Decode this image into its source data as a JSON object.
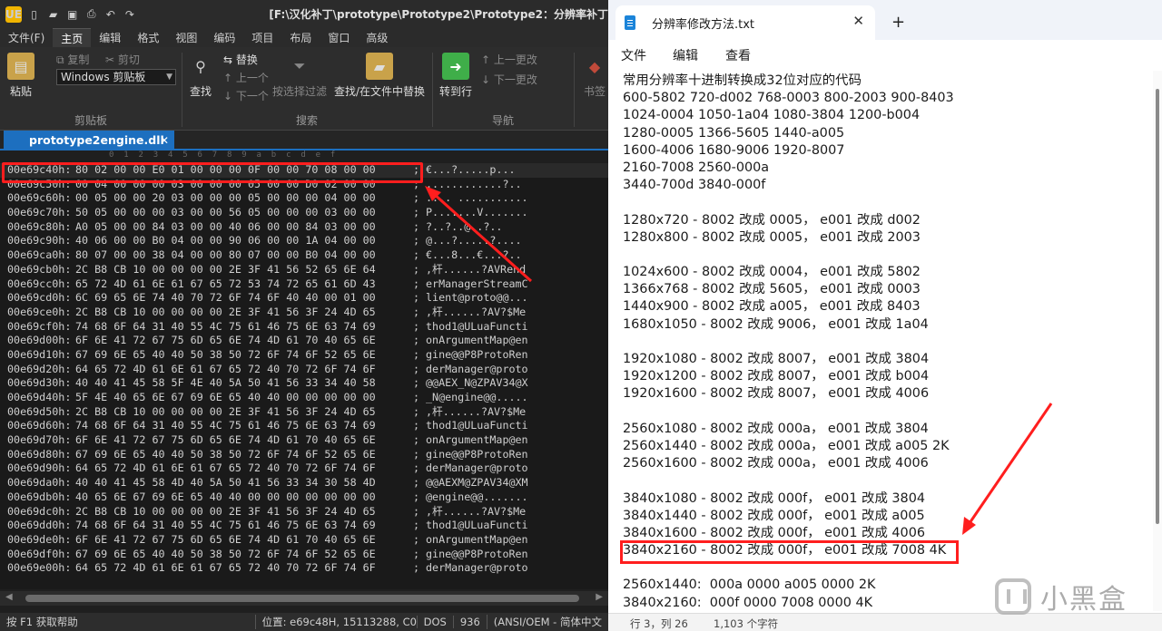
{
  "editor": {
    "logo": "UE",
    "title": "[F:\\汉化补丁\\prototype\\Prototype2\\Prototype2：分辨率补丁",
    "menu": [
      "文件(F)",
      "主页",
      "编辑",
      "格式",
      "视图",
      "编码",
      "项目",
      "布局",
      "窗口",
      "高级"
    ],
    "active_menu": "主页",
    "ribbon": {
      "paste": "粘贴",
      "copy": "复制",
      "cut": "剪切",
      "clipboard_select": "Windows 剪贴板",
      "clipboard_group": "剪贴板",
      "find": "查找",
      "replace": "替换",
      "prev": "上一个",
      "next": "下一个",
      "filter": "按选择过滤",
      "find_in_files": "查找/在文件中替换",
      "search_group": "搜索",
      "goto": "转到行",
      "prev_change": "上一更改",
      "next_change": "下一更改",
      "nav_group": "导航",
      "bookmark": "书签"
    },
    "file_tab": "prototype2engine.dll",
    "ruler": "0  1  2  3  4  5  6  7  8  9  a  b  c  d  e  f",
    "rows": [
      {
        "addr": "00e69c40h:",
        "hex": "80 02 00 00 E0 01 00 00 00 0F 00 00 70 08 00 00",
        "ascii": "€...?.....p..."
      },
      {
        "addr": "00e69c50h:",
        "hex": "00 04 00 00 00 03 00 00 00 05 00 00 D0 02 00 00",
        "ascii": "............?.."
      },
      {
        "addr": "00e69c60h:",
        "hex": "00 05 00 00 20 03 00 00 00 05 00 00 00 04 00 00",
        "ascii": ".... ..........."
      },
      {
        "addr": "00e69c70h:",
        "hex": "50 05 00 00 00 03 00 00 56 05 00 00 00 03 00 00",
        "ascii": "P.......V......."
      },
      {
        "addr": "00e69c80h:",
        "hex": "A0 05 00 00 84 03 00 00 40 06 00 00 84 03 00 00",
        "ascii": "?..?..@..?.."
      },
      {
        "addr": "00e69c90h:",
        "hex": "40 06 00 00 B0 04 00 00 90 06 00 00 1A 04 00 00",
        "ascii": "@...?.....?...."
      },
      {
        "addr": "00e69ca0h:",
        "hex": "80 07 00 00 38 04 00 00 80 07 00 00 B0 04 00 00",
        "ascii": "€...8...€...?.."
      },
      {
        "addr": "00e69cb0h:",
        "hex": "2C B8 CB 10 00 00 00 00 2E 3F 41 56 52 65 6E 64",
        "ascii": ",杆......?AVRend"
      },
      {
        "addr": "00e69cc0h:",
        "hex": "65 72 4D 61 6E 61 67 65 72 53 74 72 65 61 6D 43",
        "ascii": "erManagerStreamC"
      },
      {
        "addr": "00e69cd0h:",
        "hex": "6C 69 65 6E 74 40 70 72 6F 74 6F 40 40 00 01 00",
        "ascii": "lient@proto@@..."
      },
      {
        "addr": "00e69ce0h:",
        "hex": "2C B8 CB 10 00 00 00 00 2E 3F 41 56 3F 24 4D 65",
        "ascii": ",杆......?AV?$Me"
      },
      {
        "addr": "00e69cf0h:",
        "hex": "74 68 6F 64 31 40 55 4C 75 61 46 75 6E 63 74 69",
        "ascii": "thod1@ULuaFuncti"
      },
      {
        "addr": "00e69d00h:",
        "hex": "6F 6E 41 72 67 75 6D 65 6E 74 4D 61 70 40 65 6E",
        "ascii": "onArgumentMap@en"
      },
      {
        "addr": "00e69d10h:",
        "hex": "67 69 6E 65 40 40 50 38 50 72 6F 74 6F 52 65 6E",
        "ascii": "gine@@P8ProtoRen"
      },
      {
        "addr": "00e69d20h:",
        "hex": "64 65 72 4D 61 6E 61 67 65 72 40 70 72 6F 74 6F",
        "ascii": "derManager@proto"
      },
      {
        "addr": "00e69d30h:",
        "hex": "40 40 41 45 58 5F 4E 40 5A 50 41 56 33 34 40 58",
        "ascii": "@@AEX_N@ZPAV34@X"
      },
      {
        "addr": "00e69d40h:",
        "hex": "5F 4E 40 65 6E 67 69 6E 65 40 40 00 00 00 00 00",
        "ascii": "_N@engine@@....."
      },
      {
        "addr": "00e69d50h:",
        "hex": "2C B8 CB 10 00 00 00 00 2E 3F 41 56 3F 24 4D 65",
        "ascii": ",杆......?AV?$Me"
      },
      {
        "addr": "00e69d60h:",
        "hex": "74 68 6F 64 31 40 55 4C 75 61 46 75 6E 63 74 69",
        "ascii": "thod1@ULuaFuncti"
      },
      {
        "addr": "00e69d70h:",
        "hex": "6F 6E 41 72 67 75 6D 65 6E 74 4D 61 70 40 65 6E",
        "ascii": "onArgumentMap@en"
      },
      {
        "addr": "00e69d80h:",
        "hex": "67 69 6E 65 40 40 50 38 50 72 6F 74 6F 52 65 6E",
        "ascii": "gine@@P8ProtoRen"
      },
      {
        "addr": "00e69d90h:",
        "hex": "64 65 72 4D 61 6E 61 67 65 72 40 70 72 6F 74 6F",
        "ascii": "derManager@proto"
      },
      {
        "addr": "00e69da0h:",
        "hex": "40 40 41 45 58 4D 40 5A 50 41 56 33 34 30 58 4D",
        "ascii": "@@AEXM@ZPAV34@XM"
      },
      {
        "addr": "00e69db0h:",
        "hex": "40 65 6E 67 69 6E 65 40 40 00 00 00 00 00 00 00",
        "ascii": "@engine@@......."
      },
      {
        "addr": "00e69dc0h:",
        "hex": "2C B8 CB 10 00 00 00 00 2E 3F 41 56 3F 24 4D 65",
        "ascii": ",杆......?AV?$Me"
      },
      {
        "addr": "00e69dd0h:",
        "hex": "74 68 6F 64 31 40 55 4C 75 61 46 75 6E 63 74 69",
        "ascii": "thod1@ULuaFuncti"
      },
      {
        "addr": "00e69de0h:",
        "hex": "6F 6E 41 72 67 75 6D 65 6E 74 4D 61 70 40 65 6E",
        "ascii": "onArgumentMap@en"
      },
      {
        "addr": "00e69df0h:",
        "hex": "67 69 6E 65 40 40 50 38 50 72 6F 74 6F 52 65 6E",
        "ascii": "gine@@P8ProtoRen"
      },
      {
        "addr": "00e69e00h:",
        "hex": "64 65 72 4D 61 6E 61 67 65 72 40 70 72 6F 74 6F",
        "ascii": "derManager@proto"
      }
    ],
    "status": {
      "help": "按 F1 获取帮助",
      "position": "位置: e69c48H, 15113288, C0",
      "line_ending": "DOS",
      "codepage": "936",
      "encoding": "(ANSI/OEM - 简体中文"
    }
  },
  "notepad": {
    "tab_title": "分辨率修改方法.txt",
    "menu": [
      "文件",
      "编辑",
      "查看"
    ],
    "lines": [
      "常用分辨率十进制转换成32位对应的代码",
      "600-5802 720-d002 768-0003 800-2003 900-8403",
      "1024-0004 1050-1a04 1080-3804 1200-b004",
      "1280-0005 1366-5605 1440-a005",
      "1600-4006 1680-9006 1920-8007",
      "2160-7008 2560-000a",
      "3440-700d 3840-000f",
      "",
      "1280x720 - 8002 改成 0005， e001 改成 d002",
      "1280x800 - 8002 改成 0005， e001 改成 2003",
      "",
      "1024x600 - 8002 改成 0004， e001 改成 5802",
      "1366x768 - 8002 改成 5605， e001 改成 0003",
      "1440x900 - 8002 改成 a005， e001 改成 8403",
      "1680x1050 - 8002 改成 9006， e001 改成 1a04",
      "",
      "1920x1080 - 8002 改成 8007， e001 改成 3804",
      "1920x1200 - 8002 改成 8007， e001 改成 b004",
      "1920x1600 - 8002 改成 8007， e001 改成 4006",
      "",
      "2560x1080 - 8002 改成 000a， e001 改成 3804",
      "2560x1440 - 8002 改成 000a， e001 改成 a005 2K",
      "2560x1600 - 8002 改成 000a， e001 改成 4006",
      "",
      "3840x1080 - 8002 改成 000f， e001 改成 3804",
      "3840x1440 - 8002 改成 000f， e001 改成 a005",
      "3840x1600 - 8002 改成 000f， e001 改成 4006",
      "3840x2160 - 8002 改成 000f， e001 改成 7008 4K",
      "",
      "2560x1440:  000a 0000 a005 0000 2K",
      "3840x2160:  000f 0000 7008 0000 4K"
    ],
    "status": {
      "cursor": "行 3，列 26",
      "chars": "1,103 个字符"
    }
  },
  "watermark": {
    "text": "小黑盒"
  },
  "colors": {
    "highlight": "#ff1e1e",
    "accent": "#1d6fbf"
  }
}
